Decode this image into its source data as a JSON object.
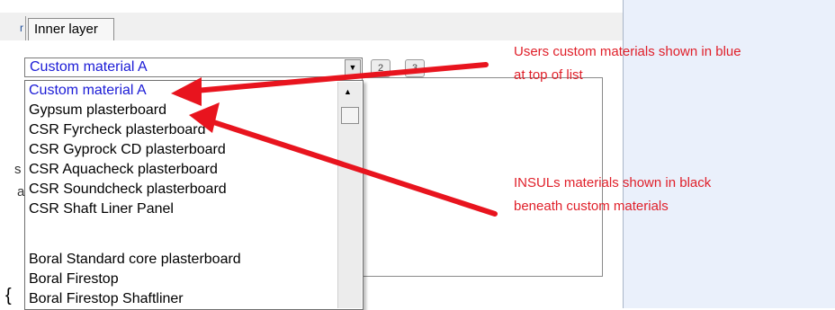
{
  "tab": {
    "label": "Inner layer"
  },
  "combo": {
    "selected": "Custom material A",
    "buttons": [
      "2",
      "3"
    ]
  },
  "dropdown": {
    "items": [
      {
        "label": "Custom material A",
        "custom": true
      },
      {
        "label": "Gypsum plasterboard",
        "custom": false
      },
      {
        "label": "CSR Fyrcheck plasterboard",
        "custom": false
      },
      {
        "label": "CSR Gyprock CD plasterboard",
        "custom": false
      },
      {
        "label": "CSR Aquacheck plasterboard",
        "custom": false
      },
      {
        "label": "CSR Soundcheck plasterboard",
        "custom": false
      },
      {
        "label": "CSR Shaft Liner Panel",
        "custom": false
      },
      {
        "label": "",
        "custom": false
      },
      {
        "label": "Boral Standard core plasterboard",
        "custom": false
      },
      {
        "label": "Boral Firestop",
        "custom": false
      },
      {
        "label": "Boral Firestop Shaftliner",
        "custom": false
      }
    ]
  },
  "annotations": {
    "custom_line1": "Users custom materials shown in blue",
    "custom_line2": "at top of list",
    "insul_line1": "INSULs materials shown in black",
    "insul_line2": "beneath custom materials"
  },
  "colors": {
    "custom_text": "#1b1bd6",
    "annotation": "#e0202a",
    "right_panel": "#eaf0fb"
  }
}
